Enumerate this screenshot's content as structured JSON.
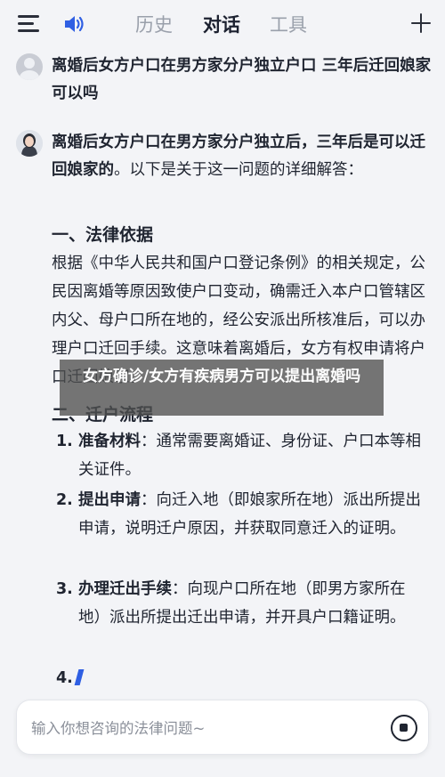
{
  "header": {
    "tabs": [
      {
        "label": "历史"
      },
      {
        "label": "对话"
      },
      {
        "label": "工具"
      }
    ],
    "active_tab": "对话",
    "icons": [
      "menu-icon",
      "speaker-icon",
      "plus-icon"
    ]
  },
  "conversation": {
    "user_question": "离婚后女方户口在男方家分户独立户口 三年后迁回娘家可以吗",
    "answer_intro_bold": "离婚后女方户口在男方家分户独立后，三年后是可以迁回娘家的",
    "answer_intro_rest": "。以下是关于这一问题的详细解答：",
    "section1_title": "一、法律依据",
    "section1_body": "根据《中华人民共和国户口登记条例》的相关规定，公民因离婚等原因致使户口变动，确需迁入本户口管辖区内父、母户口所在地的，经公安派出所核准后，可以办理户口迁回手续。这意味着离婚后，女方有权申请将户口迁回娘家。",
    "section2_title": "二、迁户流程",
    "steps": [
      {
        "num": "1.",
        "title": "准备材料",
        "body": "：通常需要离婚证、身份证、户口本等相关证件。"
      },
      {
        "num": "2.",
        "title": "提出申请",
        "body": "：向迁入地（即娘家所在地）派出所提出申请，说明迁户原因，并获取同意迁入的证明。"
      },
      {
        "num": "3.",
        "title": "办理迁出手续",
        "body": "：向现户口所在地（即男方家所在地）派出所提出迁出申请，并开具户口籍证明。"
      },
      {
        "num": "4.",
        "title": "",
        "body": ""
      }
    ]
  },
  "overlay_caption": "女方确诊/女方有疾病男方可以提出离婚吗",
  "input": {
    "placeholder": "输入你想咨询的法律问题~",
    "value": ""
  },
  "colors": {
    "background": "#f3f4f7",
    "accent": "#2f5fe3",
    "text": "#1f2430",
    "inactive_tab": "#9aa0ab"
  }
}
